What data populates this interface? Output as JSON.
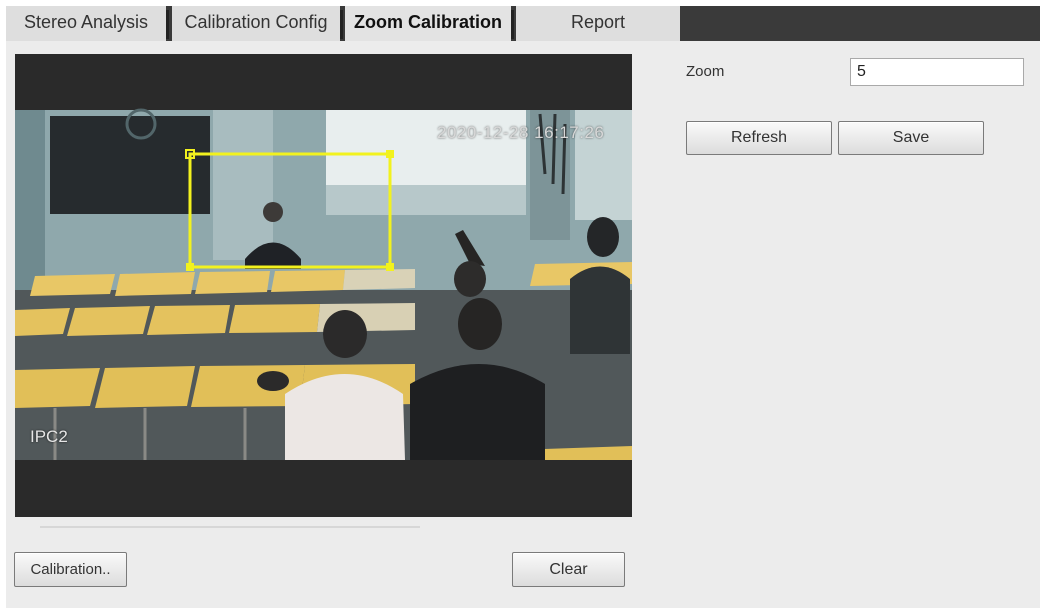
{
  "tabs": [
    {
      "label": "Stereo Analysis",
      "active": false
    },
    {
      "label": "Calibration Config",
      "active": false
    },
    {
      "label": "Zoom Calibration",
      "active": true
    },
    {
      "label": "Report",
      "active": false
    }
  ],
  "video": {
    "timestamp": "2020-12-28 16:17:26",
    "channel": "IPC2",
    "overlay_color": "#f2f21e"
  },
  "zoom": {
    "label": "Zoom",
    "value": "5"
  },
  "buttons": {
    "refresh": "Refresh",
    "save": "Save",
    "calibration": "Calibration..",
    "clear": "Clear"
  },
  "colors": {
    "tab_bar_background": "#3a3a3a",
    "panel_background": "#ececec",
    "video_background": "#2a2a2a"
  }
}
